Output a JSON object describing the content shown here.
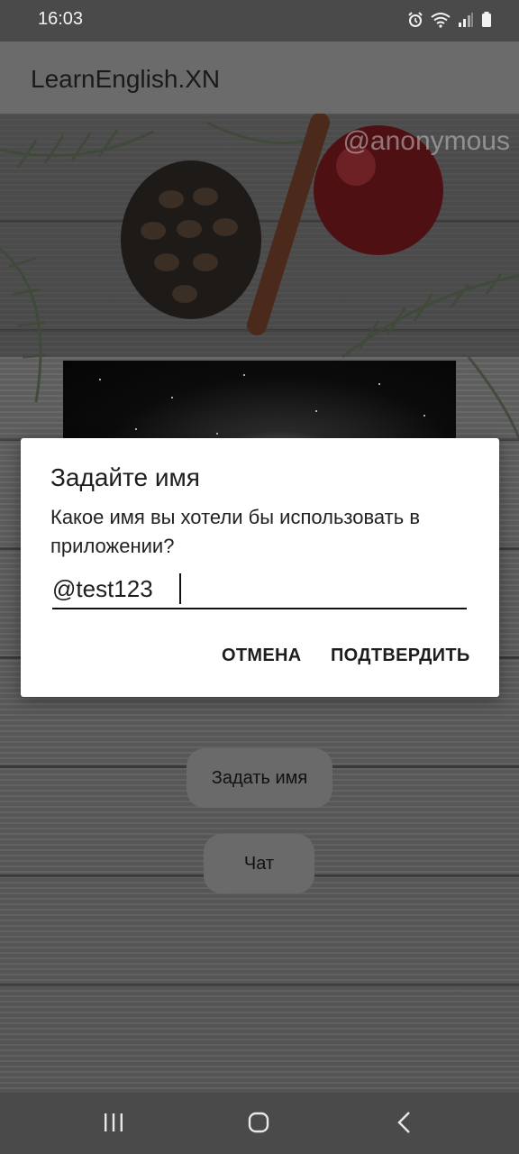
{
  "status_bar": {
    "time": "16:03",
    "icons": [
      "alarm-icon",
      "wifi-icon",
      "signal-icon",
      "battery-icon"
    ]
  },
  "app_bar": {
    "title": "LearnEnglish.XN"
  },
  "background": {
    "watermark": "@anonymous"
  },
  "main": {
    "set_name_button": "Задать имя",
    "chat_button": "Чат"
  },
  "dialog": {
    "title": "Задайте имя",
    "message": "Какое имя вы хотели бы использовать в приложении?",
    "input_value": "@test123",
    "cancel_label": "ОТМЕНА",
    "confirm_label": "ПОДТВЕРДИТЬ"
  },
  "nav_bar": {
    "icons": [
      "recent-apps-icon",
      "home-icon",
      "back-icon"
    ]
  },
  "colors": {
    "dialog_bg": "#ffffff",
    "scrim": "#3b3b3b",
    "text": "#1d1d1d"
  }
}
